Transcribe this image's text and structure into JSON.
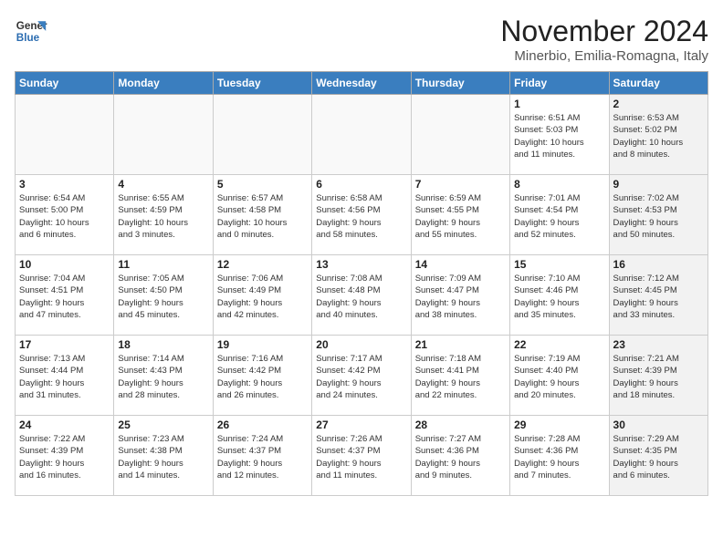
{
  "header": {
    "logo_line1": "General",
    "logo_line2": "Blue",
    "month": "November 2024",
    "location": "Minerbio, Emilia-Romagna, Italy"
  },
  "weekdays": [
    "Sunday",
    "Monday",
    "Tuesday",
    "Wednesday",
    "Thursday",
    "Friday",
    "Saturday"
  ],
  "weeks": [
    [
      {
        "day": "",
        "info": "",
        "shaded": false,
        "empty": true
      },
      {
        "day": "",
        "info": "",
        "shaded": false,
        "empty": true
      },
      {
        "day": "",
        "info": "",
        "shaded": false,
        "empty": true
      },
      {
        "day": "",
        "info": "",
        "shaded": false,
        "empty": true
      },
      {
        "day": "",
        "info": "",
        "shaded": false,
        "empty": true
      },
      {
        "day": "1",
        "info": "Sunrise: 6:51 AM\nSunset: 5:03 PM\nDaylight: 10 hours\nand 11 minutes.",
        "shaded": false,
        "empty": false
      },
      {
        "day": "2",
        "info": "Sunrise: 6:53 AM\nSunset: 5:02 PM\nDaylight: 10 hours\nand 8 minutes.",
        "shaded": true,
        "empty": false
      }
    ],
    [
      {
        "day": "3",
        "info": "Sunrise: 6:54 AM\nSunset: 5:00 PM\nDaylight: 10 hours\nand 6 minutes.",
        "shaded": false,
        "empty": false
      },
      {
        "day": "4",
        "info": "Sunrise: 6:55 AM\nSunset: 4:59 PM\nDaylight: 10 hours\nand 3 minutes.",
        "shaded": false,
        "empty": false
      },
      {
        "day": "5",
        "info": "Sunrise: 6:57 AM\nSunset: 4:58 PM\nDaylight: 10 hours\nand 0 minutes.",
        "shaded": false,
        "empty": false
      },
      {
        "day": "6",
        "info": "Sunrise: 6:58 AM\nSunset: 4:56 PM\nDaylight: 9 hours\nand 58 minutes.",
        "shaded": false,
        "empty": false
      },
      {
        "day": "7",
        "info": "Sunrise: 6:59 AM\nSunset: 4:55 PM\nDaylight: 9 hours\nand 55 minutes.",
        "shaded": false,
        "empty": false
      },
      {
        "day": "8",
        "info": "Sunrise: 7:01 AM\nSunset: 4:54 PM\nDaylight: 9 hours\nand 52 minutes.",
        "shaded": false,
        "empty": false
      },
      {
        "day": "9",
        "info": "Sunrise: 7:02 AM\nSunset: 4:53 PM\nDaylight: 9 hours\nand 50 minutes.",
        "shaded": true,
        "empty": false
      }
    ],
    [
      {
        "day": "10",
        "info": "Sunrise: 7:04 AM\nSunset: 4:51 PM\nDaylight: 9 hours\nand 47 minutes.",
        "shaded": false,
        "empty": false
      },
      {
        "day": "11",
        "info": "Sunrise: 7:05 AM\nSunset: 4:50 PM\nDaylight: 9 hours\nand 45 minutes.",
        "shaded": false,
        "empty": false
      },
      {
        "day": "12",
        "info": "Sunrise: 7:06 AM\nSunset: 4:49 PM\nDaylight: 9 hours\nand 42 minutes.",
        "shaded": false,
        "empty": false
      },
      {
        "day": "13",
        "info": "Sunrise: 7:08 AM\nSunset: 4:48 PM\nDaylight: 9 hours\nand 40 minutes.",
        "shaded": false,
        "empty": false
      },
      {
        "day": "14",
        "info": "Sunrise: 7:09 AM\nSunset: 4:47 PM\nDaylight: 9 hours\nand 38 minutes.",
        "shaded": false,
        "empty": false
      },
      {
        "day": "15",
        "info": "Sunrise: 7:10 AM\nSunset: 4:46 PM\nDaylight: 9 hours\nand 35 minutes.",
        "shaded": false,
        "empty": false
      },
      {
        "day": "16",
        "info": "Sunrise: 7:12 AM\nSunset: 4:45 PM\nDaylight: 9 hours\nand 33 minutes.",
        "shaded": true,
        "empty": false
      }
    ],
    [
      {
        "day": "17",
        "info": "Sunrise: 7:13 AM\nSunset: 4:44 PM\nDaylight: 9 hours\nand 31 minutes.",
        "shaded": false,
        "empty": false
      },
      {
        "day": "18",
        "info": "Sunrise: 7:14 AM\nSunset: 4:43 PM\nDaylight: 9 hours\nand 28 minutes.",
        "shaded": false,
        "empty": false
      },
      {
        "day": "19",
        "info": "Sunrise: 7:16 AM\nSunset: 4:42 PM\nDaylight: 9 hours\nand 26 minutes.",
        "shaded": false,
        "empty": false
      },
      {
        "day": "20",
        "info": "Sunrise: 7:17 AM\nSunset: 4:42 PM\nDaylight: 9 hours\nand 24 minutes.",
        "shaded": false,
        "empty": false
      },
      {
        "day": "21",
        "info": "Sunrise: 7:18 AM\nSunset: 4:41 PM\nDaylight: 9 hours\nand 22 minutes.",
        "shaded": false,
        "empty": false
      },
      {
        "day": "22",
        "info": "Sunrise: 7:19 AM\nSunset: 4:40 PM\nDaylight: 9 hours\nand 20 minutes.",
        "shaded": false,
        "empty": false
      },
      {
        "day": "23",
        "info": "Sunrise: 7:21 AM\nSunset: 4:39 PM\nDaylight: 9 hours\nand 18 minutes.",
        "shaded": true,
        "empty": false
      }
    ],
    [
      {
        "day": "24",
        "info": "Sunrise: 7:22 AM\nSunset: 4:39 PM\nDaylight: 9 hours\nand 16 minutes.",
        "shaded": false,
        "empty": false
      },
      {
        "day": "25",
        "info": "Sunrise: 7:23 AM\nSunset: 4:38 PM\nDaylight: 9 hours\nand 14 minutes.",
        "shaded": false,
        "empty": false
      },
      {
        "day": "26",
        "info": "Sunrise: 7:24 AM\nSunset: 4:37 PM\nDaylight: 9 hours\nand 12 minutes.",
        "shaded": false,
        "empty": false
      },
      {
        "day": "27",
        "info": "Sunrise: 7:26 AM\nSunset: 4:37 PM\nDaylight: 9 hours\nand 11 minutes.",
        "shaded": false,
        "empty": false
      },
      {
        "day": "28",
        "info": "Sunrise: 7:27 AM\nSunset: 4:36 PM\nDaylight: 9 hours\nand 9 minutes.",
        "shaded": false,
        "empty": false
      },
      {
        "day": "29",
        "info": "Sunrise: 7:28 AM\nSunset: 4:36 PM\nDaylight: 9 hours\nand 7 minutes.",
        "shaded": false,
        "empty": false
      },
      {
        "day": "30",
        "info": "Sunrise: 7:29 AM\nSunset: 4:35 PM\nDaylight: 9 hours\nand 6 minutes.",
        "shaded": true,
        "empty": false
      }
    ]
  ]
}
